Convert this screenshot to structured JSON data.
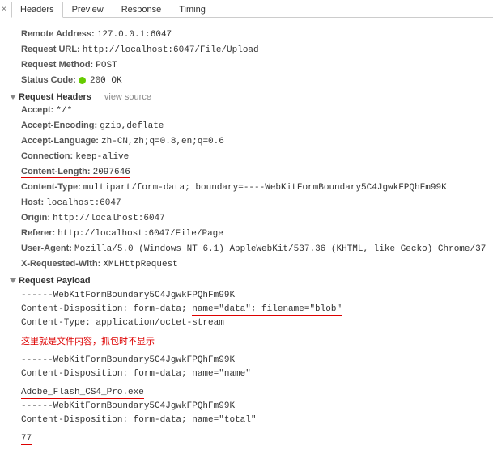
{
  "close": "×",
  "tabs": {
    "headers": "Headers",
    "preview": "Preview",
    "response": "Response",
    "timing": "Timing"
  },
  "general": {
    "remote_addr_label": "Remote Address:",
    "remote_addr": "127.0.0.1:6047",
    "url_label": "Request URL:",
    "url": "http://localhost:6047/File/Upload",
    "method_label": "Request Method:",
    "method": "POST",
    "status_label": "Status Code:",
    "status": "200 OK"
  },
  "reqhdr": {
    "title": "Request Headers",
    "view_source": "view source",
    "accept_l": "Accept:",
    "accept": "*/*",
    "accenc_l": "Accept-Encoding:",
    "accenc": "gzip,deflate",
    "acclang_l": "Accept-Language:",
    "acclang": "zh-CN,zh;q=0.8,en;q=0.6",
    "conn_l": "Connection:",
    "conn": "keep-alive",
    "clen_l": "Content-Length:",
    "clen": "2097646",
    "ctype_l": "Content-Type:",
    "ctype": "multipart/form-data; boundary=----WebKitFormBoundary5C4JgwkFPQhFm99K",
    "host_l": "Host:",
    "host": "localhost:6047",
    "origin_l": "Origin:",
    "origin": "http://localhost:6047",
    "referer_l": "Referer:",
    "referer": "http://localhost:6047/File/Page",
    "ua_l": "User-Agent:",
    "ua": "Mozilla/5.0 (Windows NT 6.1) AppleWebKit/537.36 (KHTML, like Gecko) Chrome/37",
    "xreq_l": "X-Requested-With:",
    "xreq": "XMLHttpRequest"
  },
  "payload": {
    "title": "Request Payload",
    "b1": "------WebKitFormBoundary5C4JgwkFPQhFm99K",
    "cd1_pre": "Content-Disposition: form-data; ",
    "cd1_u": "name=\"data\"; filename=\"blob\"",
    "ct1": "Content-Type: application/octet-stream",
    "note": "这里就是文件内容，抓包时不显示",
    "b2": "------WebKitFormBoundary5C4JgwkFPQhFm99K",
    "cd2_pre": "Content-Disposition: form-data; ",
    "cd2_u": "name=\"name\"",
    "file": "Adobe_Flash_CS4_Pro.exe",
    "b3": "------WebKitFormBoundary5C4JgwkFPQhFm99K",
    "cd3_pre": "Content-Disposition: form-data; ",
    "cd3_u": "name=\"total\"",
    "total": "77"
  }
}
